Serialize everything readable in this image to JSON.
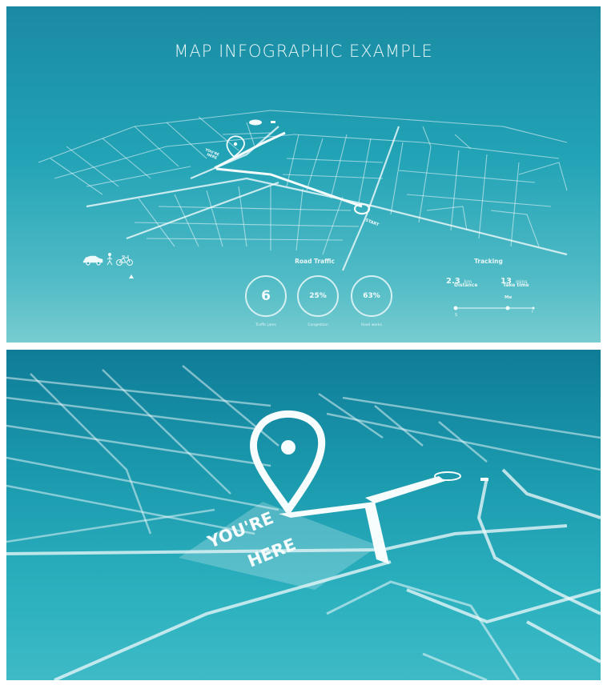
{
  "top_panel": {
    "title": "MAP INFOGRAPHIC EXAMPLE",
    "map": {
      "pin_label_line1": "YOU'RE",
      "pin_label_line2": "HERE",
      "start_label": "START"
    },
    "transport_modes": [
      "car",
      "walk",
      "bicycle"
    ],
    "road_traffic": {
      "heading": "Road Traffic",
      "metrics": [
        {
          "value": "6",
          "label": "Traffic jams"
        },
        {
          "value": "25%",
          "label": "Congestion"
        },
        {
          "value": "63%",
          "label": "Road works"
        }
      ]
    },
    "tracking": {
      "heading": "Tracking",
      "distance_value": "2.3",
      "distance_unit": "km",
      "distance_label": "Distance",
      "time_value": "13",
      "time_unit": "mins",
      "time_label": "Take time",
      "me_label": "Me",
      "start_marker": "S",
      "end_marker": "F"
    }
  },
  "bottom_panel": {
    "label_line1": "YOU'RE",
    "label_line2": "HERE"
  },
  "colors": {
    "line": "#e9f6f7",
    "top_bg_top": "#1a8aa2",
    "top_bg_bottom": "#78ccd0",
    "bottom_bg_top": "#0f7c97",
    "bottom_bg_bottom": "#3ebac6"
  }
}
